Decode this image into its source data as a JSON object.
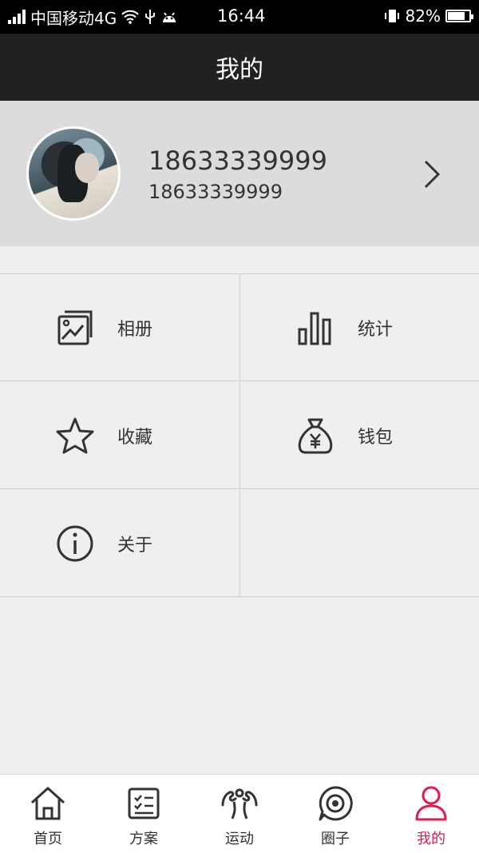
{
  "status_bar": {
    "carrier": "中国移动4G",
    "time": "16:44",
    "battery": "82%",
    "battery_level": 0.82
  },
  "header": {
    "title": "我的"
  },
  "profile": {
    "name": "18633339999",
    "phone": "18633339999",
    "avatar_icon": "user-photo"
  },
  "menu": [
    {
      "label": "相册",
      "icon": "album-icon"
    },
    {
      "label": "统计",
      "icon": "stats-icon"
    },
    {
      "label": "收藏",
      "icon": "star-icon"
    },
    {
      "label": "钱包",
      "icon": "wallet-icon"
    },
    {
      "label": "关于",
      "icon": "info-icon"
    }
  ],
  "tabs": [
    {
      "label": "首页",
      "icon": "home-icon"
    },
    {
      "label": "方案",
      "icon": "plan-icon"
    },
    {
      "label": "运动",
      "icon": "muscle-icon"
    },
    {
      "label": "圈子",
      "icon": "circle-icon"
    },
    {
      "label": "我的",
      "icon": "person-icon",
      "active": true
    }
  ],
  "colors": {
    "accent": "#e5174f",
    "header_bg": "#212121",
    "profile_bg": "#dcdcdc",
    "page_bg": "#efefef"
  }
}
